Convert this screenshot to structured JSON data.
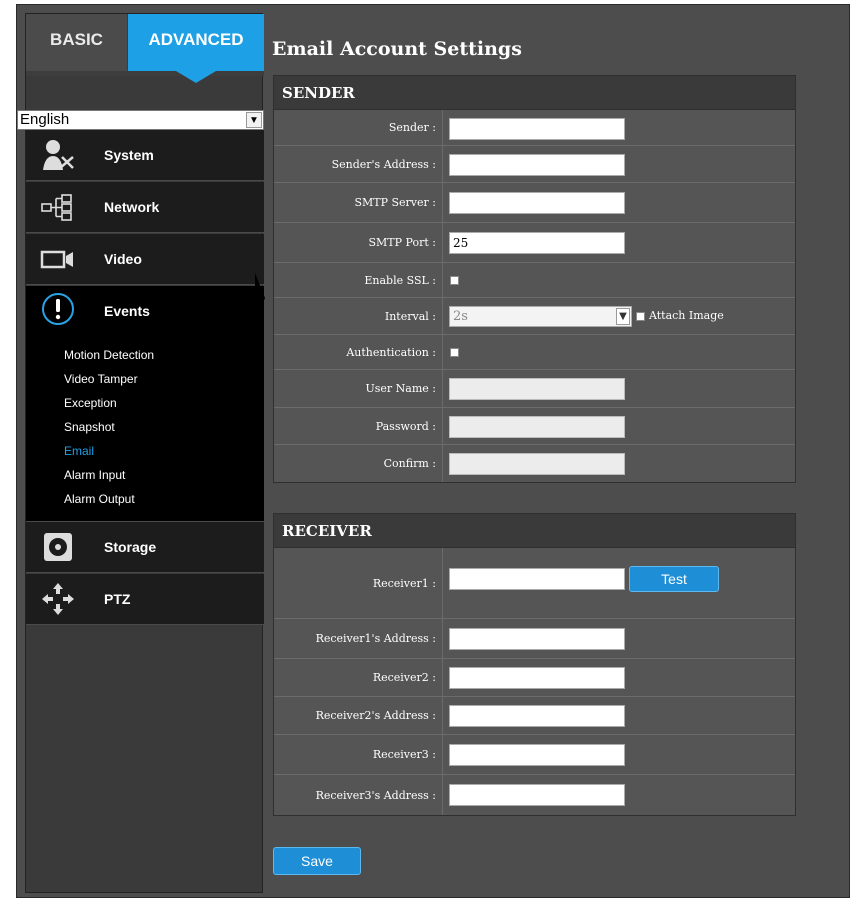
{
  "sidebar": {
    "tabs": {
      "basic": "BASIC",
      "advanced": "ADVANCED"
    },
    "language": "English",
    "menu": {
      "system": "System",
      "network": "Network",
      "video": "Video",
      "events": "Events",
      "storage": "Storage",
      "ptz": "PTZ"
    },
    "events_sub": [
      "Motion Detection",
      "Video Tamper",
      "Exception",
      "Snapshot",
      "Email",
      "Alarm Input",
      "Alarm Output"
    ],
    "active_sub": "Email"
  },
  "main": {
    "title": "Email Account Settings",
    "sender": {
      "header": "SENDER",
      "labels": {
        "sender": "Sender",
        "address": "Sender's Address",
        "smtp_server": "SMTP Server",
        "smtp_port": "SMTP Port",
        "enable_ssl": "Enable SSL",
        "interval": "Interval",
        "authentication": "Authentication",
        "user_name": "User Name",
        "password": "Password",
        "confirm": "Confirm"
      },
      "values": {
        "sender": "",
        "address": "",
        "smtp_server": "",
        "smtp_port": "25",
        "interval": "2s",
        "user_name": "",
        "password": "",
        "confirm": ""
      },
      "attach_image": "Attach Image"
    },
    "receiver": {
      "header": "RECEIVER",
      "labels": {
        "receiver1": "Receiver1",
        "receiver1_address": "Receiver1's Address",
        "receiver2": "Receiver2",
        "receiver2_address": "Receiver2's Address",
        "receiver3": "Receiver3",
        "receiver3_address": "Receiver3's Address"
      },
      "test_button": "Test"
    },
    "save_button": "Save"
  },
  "colors": {
    "accent": "#1ea0e6",
    "panel": "#555555",
    "sidebar": "#1c1c1c"
  }
}
